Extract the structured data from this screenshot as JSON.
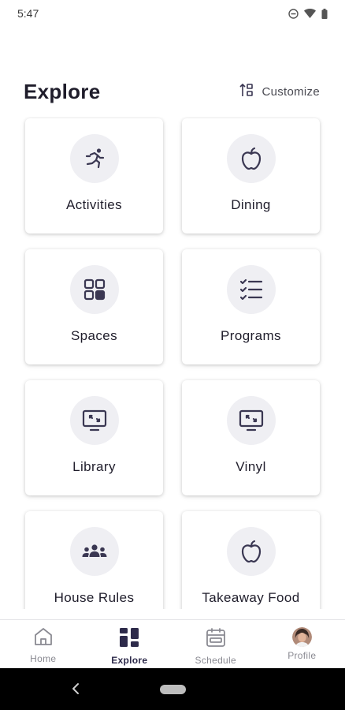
{
  "status_bar": {
    "time": "5:47",
    "icons": [
      "do-not-disturb-icon",
      "wifi-icon",
      "battery-icon"
    ]
  },
  "header": {
    "title": "Explore",
    "customize_label": "Customize",
    "customize_icon": "sort-customize-icon"
  },
  "tiles": [
    {
      "label": "Activities",
      "icon": "running-person-icon"
    },
    {
      "label": "Dining",
      "icon": "apple-icon"
    },
    {
      "label": "Spaces",
      "icon": "grid-squares-icon"
    },
    {
      "label": "Programs",
      "icon": "checklist-icon"
    },
    {
      "label": "Library",
      "icon": "monitor-icon"
    },
    {
      "label": "Vinyl",
      "icon": "monitor-icon"
    },
    {
      "label": "House Rules",
      "icon": "people-group-icon"
    },
    {
      "label": "Takeaway Food",
      "icon": "apple-icon"
    }
  ],
  "bottom_nav": {
    "items": [
      {
        "label": "Home",
        "icon": "home-icon",
        "active": false
      },
      {
        "label": "Explore",
        "icon": "explore-grid-icon",
        "active": true
      },
      {
        "label": "Schedule",
        "icon": "calendar-icon",
        "active": false
      },
      {
        "label": "Profile",
        "icon": "avatar",
        "active": false
      }
    ]
  },
  "colors": {
    "icon": "#3a3752",
    "icon_bg": "#efeff3",
    "active_nav": "#2d2a4a",
    "inactive_nav": "#8a8a92"
  }
}
